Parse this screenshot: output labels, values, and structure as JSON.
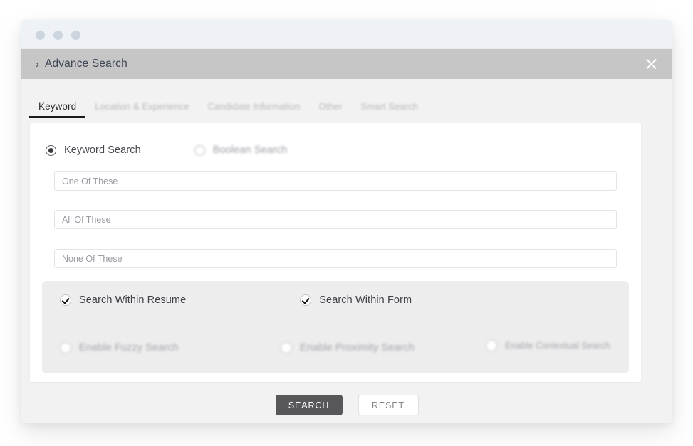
{
  "window": {
    "traffic_lights": [
      "dot-red",
      "dot-yellow",
      "dot-green"
    ]
  },
  "modal": {
    "chevron": "›",
    "title": "Advance Search",
    "close_label": "×"
  },
  "tabs": [
    {
      "label": "Keyword",
      "active": true
    },
    {
      "label": "Location & Experience",
      "active": false
    },
    {
      "label": "Candidate Information",
      "active": false
    },
    {
      "label": "Other",
      "active": false
    },
    {
      "label": "Smart Search",
      "active": false
    }
  ],
  "search_mode": {
    "keyword": {
      "label": "Keyword Search",
      "selected": true
    },
    "boolean": {
      "label": "Boolean Search",
      "selected": false
    }
  },
  "fields": {
    "one_of_these": {
      "placeholder": "One Of These",
      "value": ""
    },
    "all_of_these": {
      "placeholder": "All Of These",
      "value": ""
    },
    "none_of_these": {
      "placeholder": "None Of These",
      "value": ""
    }
  },
  "options": {
    "search_within_resume": {
      "label": "Search Within Resume",
      "checked": true
    },
    "search_within_form": {
      "label": "Search Within Form",
      "checked": true
    },
    "enable_fuzzy_search": {
      "label": "Enable Fuzzy Search",
      "selected": false
    },
    "enable_proximity_search": {
      "label": "Enable Proximity Search",
      "selected": false
    },
    "enable_contextual_search": {
      "label": "Enable Contextual Search",
      "selected": false
    }
  },
  "buttons": {
    "search": "SEARCH",
    "reset": "RESET"
  },
  "colors": {
    "page_background": "#ffffff",
    "chrome_bar": "#eef2f6",
    "title_bar": "#c6c6c6",
    "title_text": "#3f4656",
    "modal_body": "#f2f2f2",
    "card": "#ffffff",
    "inner_panel": "#ededed",
    "active_tab_underline": "#1b1b1b",
    "search_button": "#58585a",
    "reset_button_border": "#e0e0e2"
  }
}
